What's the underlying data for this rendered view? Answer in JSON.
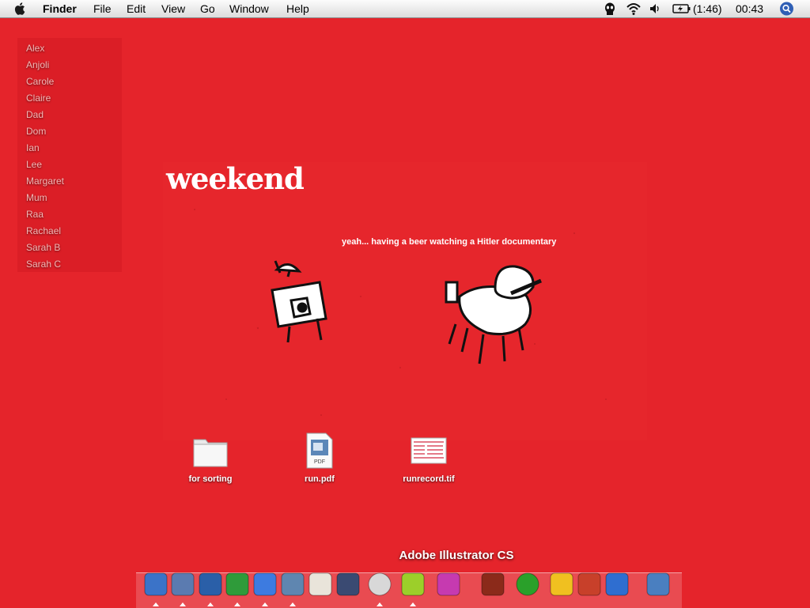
{
  "menubar": {
    "app": "Finder",
    "items": [
      "File",
      "Edit",
      "View",
      "Go",
      "Window",
      "Help"
    ],
    "battery": "(1:46)",
    "clock": "00:43"
  },
  "names": [
    "Alex",
    "Anjoli",
    "Carole",
    "Claire",
    "Dad",
    "Dom",
    "Ian",
    "Lee",
    "Margaret",
    "Mum",
    "Raa",
    "Rachael",
    "Sarah B",
    "Sarah C"
  ],
  "picture": {
    "title": "weekend",
    "caption": "yeah... having a beer watching a Hitler documentary"
  },
  "desktop": {
    "items": [
      {
        "label": "for sorting",
        "icon": "folder-icon"
      },
      {
        "label": "run.pdf",
        "icon": "pdf-icon",
        "badge": "PDF"
      },
      {
        "label": "runrecord.tif",
        "icon": "tif-image-icon"
      }
    ]
  },
  "dock": {
    "hover_label": "Adobe Illustrator CS",
    "apps": [
      "finder-icon",
      "mail-icon",
      "safari-icon",
      "adium-icon",
      "ichat-icon",
      "iphoto-icon",
      "textedit-icon",
      "pen-icon",
      "itunes-icon",
      "ticket-icon",
      "eraser-icon",
      "illustrator-icon",
      "dreamweaver-icon",
      "stuffit-icon",
      "utility-icon",
      "bluetooth-icon",
      "trash-icon"
    ]
  }
}
